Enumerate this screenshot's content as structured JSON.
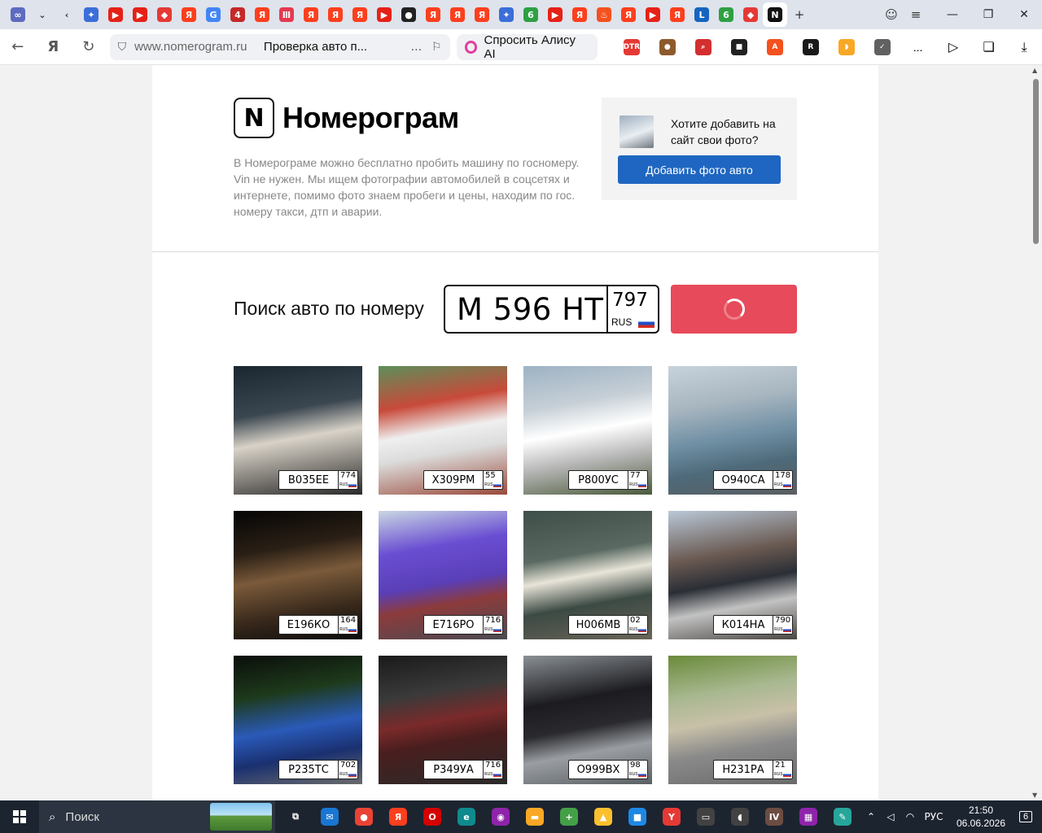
{
  "browser": {
    "url_host": "www.nomerogram.ru",
    "page_title": "Проверка авто п...",
    "alice_label": "Спросить Алису AI",
    "more": "...",
    "tabs": [
      {
        "name": "infinity-tab-icon",
        "glyph": "∞",
        "color": "#5c6bc0"
      },
      {
        "name": "dropdown-tab-icon",
        "glyph": "",
        "color": "#dfe3ec"
      },
      {
        "name": "back-tab-icon",
        "glyph": "",
        "color": "#dfe3ec"
      },
      {
        "name": "bird-tab-icon",
        "glyph": "✦",
        "color": "#3b6ed8"
      },
      {
        "name": "youtube-tab-icon",
        "glyph": "▶",
        "color": "#e62117"
      },
      {
        "name": "youtube-tab-icon",
        "glyph": "▶",
        "color": "#e62117"
      },
      {
        "name": "car-red-tab-icon",
        "glyph": "◆",
        "color": "#e53935"
      },
      {
        "name": "yandex-tab-icon",
        "glyph": "Я",
        "color": "#fc3f1d"
      },
      {
        "name": "google-tab-icon",
        "glyph": "G",
        "color": "#4285f4"
      },
      {
        "name": "badge-446-tab-icon",
        "glyph": "4",
        "color": "#c62828"
      },
      {
        "name": "yandex-tab-icon",
        "glyph": "Я",
        "color": "#fc3f1d"
      },
      {
        "name": "podcast-tab-icon",
        "glyph": "Ⅲ",
        "color": "#e53950"
      },
      {
        "name": "yandex-tab-icon",
        "glyph": "Я",
        "color": "#fc3f1d"
      },
      {
        "name": "yandex-tab-icon",
        "glyph": "Я",
        "color": "#fc3f1d"
      },
      {
        "name": "yandex-tab-icon",
        "glyph": "Я",
        "color": "#fc3f1d"
      },
      {
        "name": "youtube-tab-icon",
        "glyph": "▶",
        "color": "#e62117"
      },
      {
        "name": "github-tab-icon",
        "glyph": "●",
        "color": "#222222"
      },
      {
        "name": "yandex-tab-icon",
        "glyph": "Я",
        "color": "#fc3f1d"
      },
      {
        "name": "yandex-tab-icon",
        "glyph": "Я",
        "color": "#fc3f1d"
      },
      {
        "name": "yandex-tab-icon",
        "glyph": "Я",
        "color": "#fc3f1d"
      },
      {
        "name": "bird-tab-icon",
        "glyph": "✦",
        "color": "#3b6ed8"
      },
      {
        "name": "green-six-tab-icon",
        "glyph": "6",
        "color": "#2ea043"
      },
      {
        "name": "youtube-tab-icon",
        "glyph": "▶",
        "color": "#e62117"
      },
      {
        "name": "yandex-tab-icon",
        "glyph": "Я",
        "color": "#fc3f1d"
      },
      {
        "name": "flame-tab-icon",
        "glyph": "♨",
        "color": "#f4511e"
      },
      {
        "name": "yandex-tab-icon",
        "glyph": "Я",
        "color": "#fc3f1d"
      },
      {
        "name": "youtube-tab-icon",
        "glyph": "▶",
        "color": "#e62117"
      },
      {
        "name": "yandex-tab-icon",
        "glyph": "Я",
        "color": "#fc3f1d"
      },
      {
        "name": "lc-tab-icon",
        "glyph": "L",
        "color": "#1565c0"
      },
      {
        "name": "green-six-tab-icon",
        "glyph": "6",
        "color": "#2ea043"
      },
      {
        "name": "car-red-tab-icon",
        "glyph": "◆",
        "color": "#e53935"
      },
      {
        "name": "nomerogram-tab-icon",
        "glyph": "N",
        "color": "#111111",
        "active": true
      }
    ],
    "ext_icons": [
      {
        "name": "dtr-extension-icon",
        "glyph": "DTR",
        "color": "#e53935"
      },
      {
        "name": "cookie-extension-icon",
        "glyph": "●",
        "color": "#8d5a2b"
      },
      {
        "name": "search-red-extension-icon",
        "glyph": "⌕",
        "color": "#d32f2f"
      },
      {
        "name": "dice-extension-icon",
        "glyph": "■",
        "color": "#222222"
      },
      {
        "name": "pdf-extension-icon",
        "glyph": "A",
        "color": "#f4511e"
      },
      {
        "name": "r-circle-extension-icon",
        "glyph": "R",
        "color": "#1a1a1a"
      },
      {
        "name": "sound-extension-icon",
        "glyph": "◗",
        "color": "#f9a825"
      },
      {
        "name": "shield-extension-icon",
        "glyph": "✓",
        "color": "#616161"
      }
    ]
  },
  "site": {
    "logo_letter": "N",
    "logo_name": "Номерограм",
    "description": "В Номерограме можно бесплатно пробить машину по госномеру. Vin не нужен. Мы ищем фотографии автомобилей в соцсетях и интернете, помимо фото знаем пробеги и цены, находим по гос. номеру такси, дтп и аварии.",
    "promo_text": "Хотите добавить на сайт свои фото?",
    "promo_button": "Добавить фото авто",
    "search_title": "Поиск авто по номеру",
    "plate_number": "М 596 НТ",
    "plate_region": "797",
    "plate_country": "RUS",
    "button_color": "#e74a5a",
    "brand_blue": "#1e66c1"
  },
  "cars": [
    {
      "number": "В035ЕЕ",
      "region": "774",
      "bg": "linear-gradient(170deg,#1a2630 0%,#3a4650 35%,#d8d2c8 55%,#8a8680 75%,#2a2a2a 100%)"
    },
    {
      "number": "Х309РМ",
      "region": "55",
      "bg": "linear-gradient(170deg,#5c8f5a 0%,#c84a3a 30%,#efefef 50%,#dcdcdc 65%,#9a4a3a 100%)"
    },
    {
      "number": "Р800УС",
      "region": "77",
      "bg": "linear-gradient(170deg,#9db2c4 0%,#c6cfd6 30%,#ffffff 50%,#b8b8b8 70%,#4a5a3a 100%)"
    },
    {
      "number": "О940СА",
      "region": "178",
      "bg": "linear-gradient(170deg,#c7d3dc 0%,#a8b6c0 30%,#6f8fa4 55%,#4e6a7a 75%,#5a5e60 100%)"
    },
    {
      "number": "Е196КО",
      "region": "164",
      "bg": "linear-gradient(170deg,#050505 0%,#2a1f15 30%,#7a5a3a 50%,#3a2a1c 75%,#0a0a0a 100%)"
    },
    {
      "number": "Е716РО",
      "region": "716",
      "bg": "linear-gradient(170deg,#c9d7e3 0%,#6a4ed2 30%,#5a3fb8 55%,#8c3b3b 70%,#4a4a52 100%)"
    },
    {
      "number": "Н006МВ",
      "region": "02",
      "bg": "linear-gradient(170deg,#3e4e48 0%,#5a6a62 35%,#e8e4d8 50%,#3c4a44 70%,#6a6458 100%)"
    },
    {
      "number": "К014НА",
      "region": "790",
      "bg": "linear-gradient(170deg,#b9c8d8 0%,#6a5a52 35%,#2a2e35 55%,#c2c2c2 72%,#4a4642 100%)"
    },
    {
      "number": "Р235ТС",
      "region": "702",
      "bg": "linear-gradient(170deg,#0a0e0a 0%,#1e3a1c 30%,#2a5ab8 55%,#1a3070 75%,#6a6a6a 100%)"
    },
    {
      "number": "Р349УА",
      "region": "716",
      "bg": "linear-gradient(170deg,#1a1a1a 0%,#3a3a3a 30%,#7a2a2a 50%,#4a1e1e 65%,#2a2a2a 100%)"
    },
    {
      "number": "О999ВХ",
      "region": "98",
      "bg": "linear-gradient(170deg,#8a9094 0%,#1c1c20 35%,#2a2a2e 55%,#9a9ea2 72%,#5a6064 100%)"
    },
    {
      "number": "Н231РА",
      "region": "21",
      "bg": "linear-gradient(170deg,#6a8a3a 0%,#a8b890 30%,#c8c0a8 50%,#8a8a8a 70%,#6a6a6a 100%)"
    }
  ],
  "taskbar": {
    "search_label": "Поиск",
    "language": "РУС",
    "time": "21:50",
    "date": "06.06.2026",
    "notifications": "6",
    "apps": [
      {
        "name": "task-view-icon",
        "glyph": "⧉",
        "color": "#1c2430"
      },
      {
        "name": "mail-icon",
        "glyph": "✉",
        "color": "#1976d2"
      },
      {
        "name": "chrome-icon",
        "glyph": "●",
        "color": "#ea4335"
      },
      {
        "name": "yandex-icon",
        "glyph": "Я",
        "color": "#fc3f1d"
      },
      {
        "name": "opera-icon",
        "glyph": "O",
        "color": "#d50000"
      },
      {
        "name": "edge-icon",
        "glyph": "e",
        "color": "#0f8b8d"
      },
      {
        "name": "paint-icon",
        "glyph": "◉",
        "color": "#8e24aa"
      },
      {
        "name": "folder-icon",
        "glyph": "▬",
        "color": "#f9a825"
      },
      {
        "name": "plus-green-icon",
        "glyph": "+",
        "color": "#43a047"
      },
      {
        "name": "lock-icon",
        "glyph": "▲",
        "color": "#fbc02d"
      },
      {
        "name": "roblox-icon",
        "glyph": "■",
        "color": "#1e88e5"
      },
      {
        "name": "yandex-browser-icon",
        "glyph": "Y",
        "color": "#e53935"
      },
      {
        "name": "terminal-icon",
        "glyph": "▭",
        "color": "#424242"
      },
      {
        "name": "mouse-icon",
        "glyph": "◖",
        "color": "#424242"
      },
      {
        "name": "iv-icon",
        "glyph": "IV",
        "color": "#6d4c41"
      },
      {
        "name": "winrar-icon",
        "glyph": "▦",
        "color": "#8e24aa"
      },
      {
        "name": "notepad-icon",
        "glyph": "✎",
        "color": "#26a69a"
      }
    ]
  }
}
